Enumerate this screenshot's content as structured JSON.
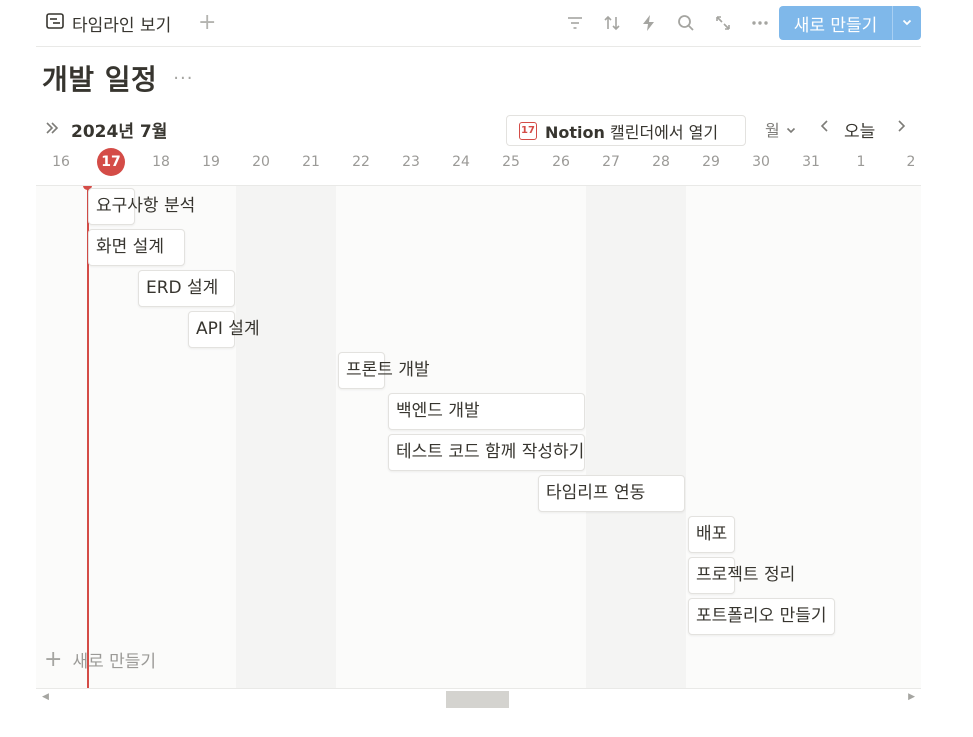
{
  "toolbar": {
    "view_label": "타임라인 보기",
    "add_view": "+",
    "new_button_label": "새로 만들기",
    "icons": [
      "filter-icon",
      "sort-icon",
      "automation-bolt-icon",
      "search-icon",
      "expand-icon",
      "more-icon"
    ]
  },
  "page": {
    "title": "개발 일정",
    "title_more": "···"
  },
  "calendar_bar": {
    "month": "2024년 7월",
    "open_calendar_brand": "Notion",
    "open_calendar_text": "캘린더에서 열기",
    "calendar_icon_day": "17",
    "range": "월",
    "today": "오늘"
  },
  "days": [
    "16",
    "17",
    "18",
    "19",
    "20",
    "21",
    "22",
    "23",
    "24",
    "25",
    "26",
    "27",
    "28",
    "29",
    "30",
    "31",
    "1",
    "2"
  ],
  "today_day": "17",
  "tasks": [
    {
      "name": "요구사항 분석"
    },
    {
      "name": "화면 설계"
    },
    {
      "name": "ERD 설계"
    },
    {
      "name": "API 설계"
    },
    {
      "name": "프론트 개발"
    },
    {
      "name": "백엔드 개발"
    },
    {
      "name": "테스트 코드 함께 작성하기"
    },
    {
      "name": "타임리프 연동"
    },
    {
      "name": "배포"
    },
    {
      "name": "프로젝트 정리"
    },
    {
      "name": "포트폴리오 만들기"
    }
  ],
  "add_new_label": "새로 만들기",
  "colors": {
    "accent_button": "#7fb8ea",
    "today_red": "#d44c47"
  }
}
